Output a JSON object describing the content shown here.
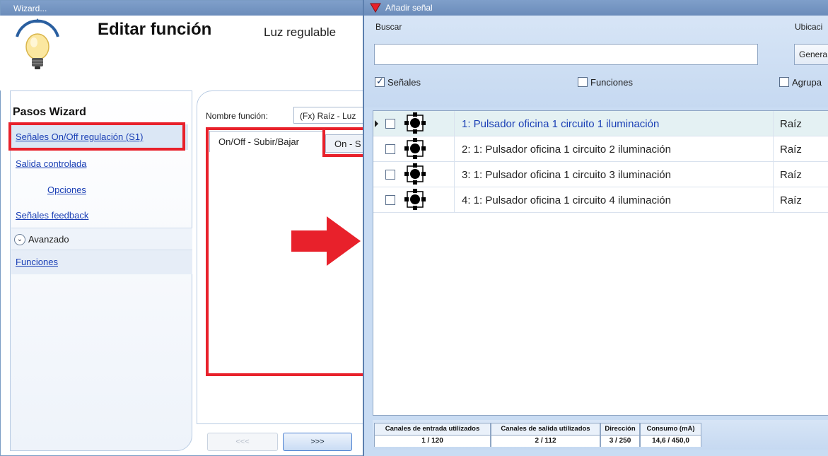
{
  "wizard": {
    "window_title": "Wizard...",
    "title": "Editar función",
    "subtitle": "Luz regulable",
    "steps_title": "Pasos Wizard",
    "steps": [
      {
        "label": "Señales On/Off regulación (S1)"
      },
      {
        "label": "Salida controlada"
      },
      {
        "label": "Opciones"
      },
      {
        "label": "Señales feedback"
      }
    ],
    "advanced_label": "Avanzado",
    "functions_label": "Funciones",
    "function_name_label": "Nombre función:",
    "function_name_value": "(Fx) Raíz - Luz",
    "tabs": [
      {
        "label": "On/Off - Subir/Bajar"
      },
      {
        "label": "On - S"
      }
    ],
    "prev_label": "<<<",
    "next_label": ">>>"
  },
  "add_signal": {
    "window_title": "Añadir señal",
    "search_label": "Buscar",
    "search_value": "",
    "location_label": "Ubicaci",
    "location_value": "Genera",
    "filters": {
      "signals": {
        "label": "Señales",
        "checked": true
      },
      "functions": {
        "label": "Funciones",
        "checked": false
      },
      "group": {
        "label": "Agrupa",
        "checked": false
      }
    },
    "rows": [
      {
        "name": "1: Pulsador oficina 1 circuito 1 iluminación",
        "location": "Raíz",
        "selected": true
      },
      {
        "name": "2: 1: Pulsador oficina 1 circuito 2 iluminación",
        "location": "Raíz",
        "selected": false
      },
      {
        "name": "3: 1: Pulsador oficina 1 circuito 3 iluminación",
        "location": "Raíz",
        "selected": false
      },
      {
        "name": "4: 1: Pulsador oficina 1 circuito 4 iluminación",
        "location": "Raíz",
        "selected": false
      }
    ],
    "status": [
      {
        "header": "Canales de entrada utilizados",
        "value": "1 / 120"
      },
      {
        "header": "Canales de salida utilizados",
        "value": "2 / 112"
      },
      {
        "header": "Dirección",
        "value": "3 / 250"
      },
      {
        "header": "Consumo (mA)",
        "value": "14,6 / 450,0"
      }
    ]
  },
  "colors": {
    "highlight": "#e8212b",
    "link": "#1a3fb5",
    "titlebar": "#7393c2"
  }
}
